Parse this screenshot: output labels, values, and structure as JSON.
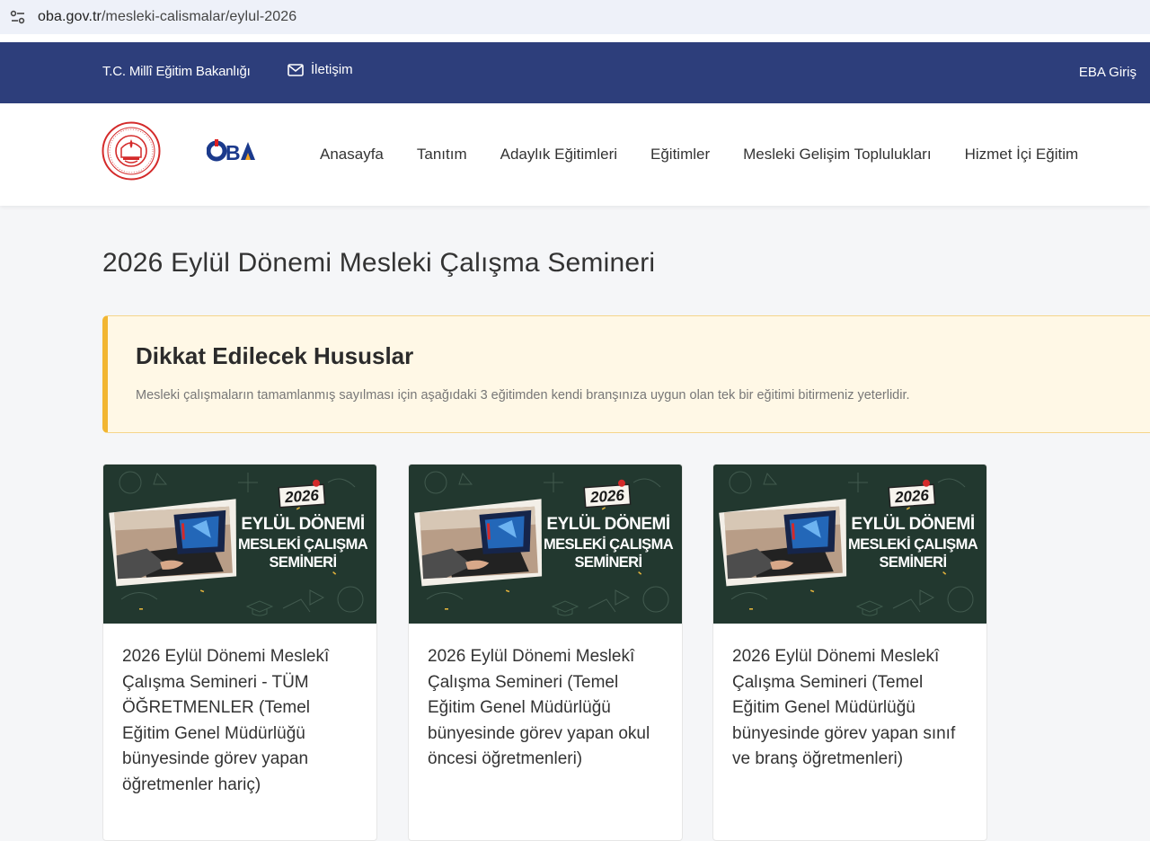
{
  "browser": {
    "url_host": "oba.gov.tr",
    "url_path": "/mesleki-calismalar/eylul-2026"
  },
  "topbar": {
    "ministry": "T.C. Millî Eğitim Bakanlığı",
    "contact": "İletişim",
    "eba_login": "EBA Giriş"
  },
  "logos": {
    "oba": "OBA"
  },
  "nav": {
    "items": [
      "Anasayfa",
      "Tanıtım",
      "Adaylık Eğitimleri",
      "Eğitimler",
      "Mesleki Gelişim Toplulukları",
      "Hizmet İçi Eğitim"
    ]
  },
  "page": {
    "title": "2026 Eylül Dönemi Mesleki Çalışma Semineri"
  },
  "notice": {
    "heading": "Dikkat Edilecek Hususlar",
    "text": "Mesleki çalışmaların tamamlanmış sayılması için aşağıdaki 3 eğitimden kendi branşınıza uygun olan tek bir eğitimi bitirmeniz yeterlidir."
  },
  "banner": {
    "year": "2026",
    "line1": "EYLÜL DÖNEMİ",
    "line2": "MESLEKİ ÇALIŞMA",
    "line3": "SEMİNERİ"
  },
  "cards": [
    {
      "title": "2026 Eylül Dönemi Meslekî Çalışma Semineri - TÜM ÖĞRETMENLER (Temel Eğitim Genel Müdürlüğü bünyesinde görev yapan öğretmenler hariç)"
    },
    {
      "title": "2026 Eylül Dönemi Meslekî Çalışma Semineri (Temel Eğitim Genel Müdürlüğü bünyesinde görev yapan okul öncesi öğretmenleri)"
    },
    {
      "title": "2026 Eylül Dönemi Meslekî Çalışma Semineri (Temel Eğitim Genel Müdürlüğü bünyesinde görev yapan sınıf ve branş öğretmenleri)"
    }
  ],
  "colors": {
    "topbar": "#2d3e7b",
    "notice_bg": "#fff8e6",
    "notice_accent": "#f2b632",
    "banner_bg": "#22382f"
  }
}
